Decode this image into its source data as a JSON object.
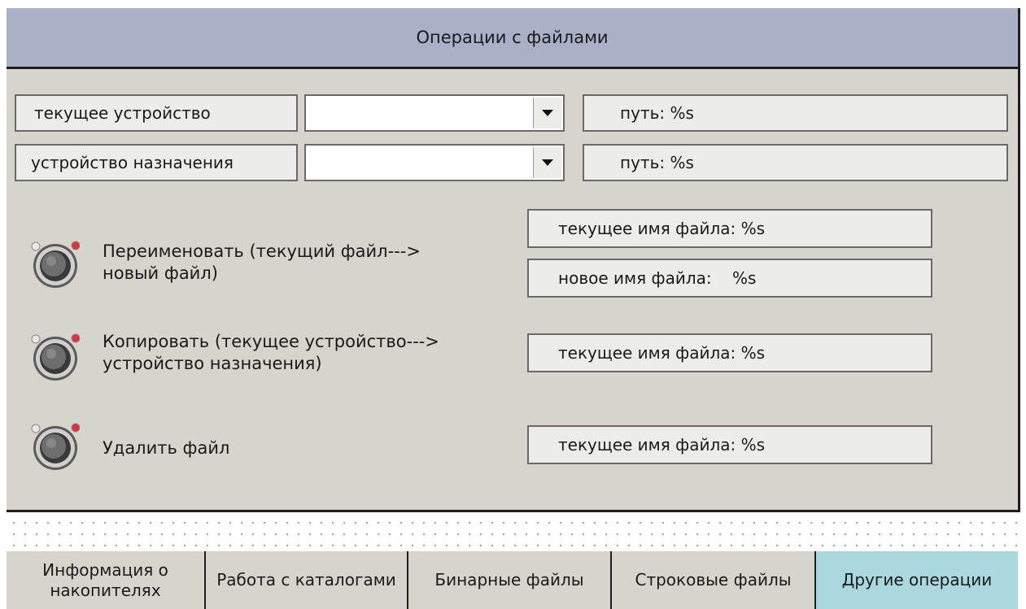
{
  "header": {
    "title": "Операции с файлами"
  },
  "devices": {
    "current": {
      "label": "текущее устройство",
      "value": "",
      "path": "путь: %s"
    },
    "target": {
      "label": "устройство назначения",
      "value": "",
      "path": "путь: %s"
    }
  },
  "operations": {
    "rename": {
      "label_line1": "Переименовать (текущий файл--->",
      "label_line2": "новый файл)",
      "current_name": "текущее имя файла: %s",
      "new_name": "новое имя файла:    %s"
    },
    "copy": {
      "label_line1": "Копировать (текущее устройство--->",
      "label_line2": "устройство назначения)",
      "current_name": "текущее имя файла: %s"
    },
    "delete": {
      "label": "Удалить файл",
      "current_name": "текущее имя файла: %s"
    }
  },
  "tabs": [
    {
      "label": "Информация о накопителях",
      "active": false
    },
    {
      "label": "Работа с каталогами",
      "active": false
    },
    {
      "label": "Бинарные файлы",
      "active": false
    },
    {
      "label": "Строковые файлы",
      "active": false
    },
    {
      "label": "Другие операции",
      "active": true
    }
  ],
  "colors": {
    "header_bg": "#aab0c8",
    "panel_bg": "#d7d3cd",
    "active_tab": "#a9d8de",
    "indicator_led": "#e0303a"
  }
}
